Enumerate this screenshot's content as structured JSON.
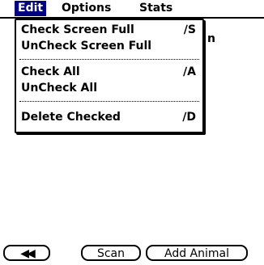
{
  "menubar": {
    "edit": "Edit",
    "options": "Options",
    "stats": "Stats"
  },
  "background": {
    "partial_text": "n"
  },
  "edit_menu": {
    "items": [
      {
        "label": "Check Screen Full",
        "shortcut": "∕S"
      },
      {
        "label": "UnCheck Screen Full",
        "shortcut": ""
      },
      {
        "label": "Check All",
        "shortcut": "∕A"
      },
      {
        "label": "UnCheck All",
        "shortcut": ""
      },
      {
        "label": "Delete Checked",
        "shortcut": "∕D"
      }
    ]
  },
  "buttons": {
    "back": "◀◀",
    "scan": "Scan",
    "add_animal": "Add Animal"
  },
  "colors": {
    "menu_highlight": "#000080",
    "foreground": "#000000",
    "background": "#ffffff"
  }
}
